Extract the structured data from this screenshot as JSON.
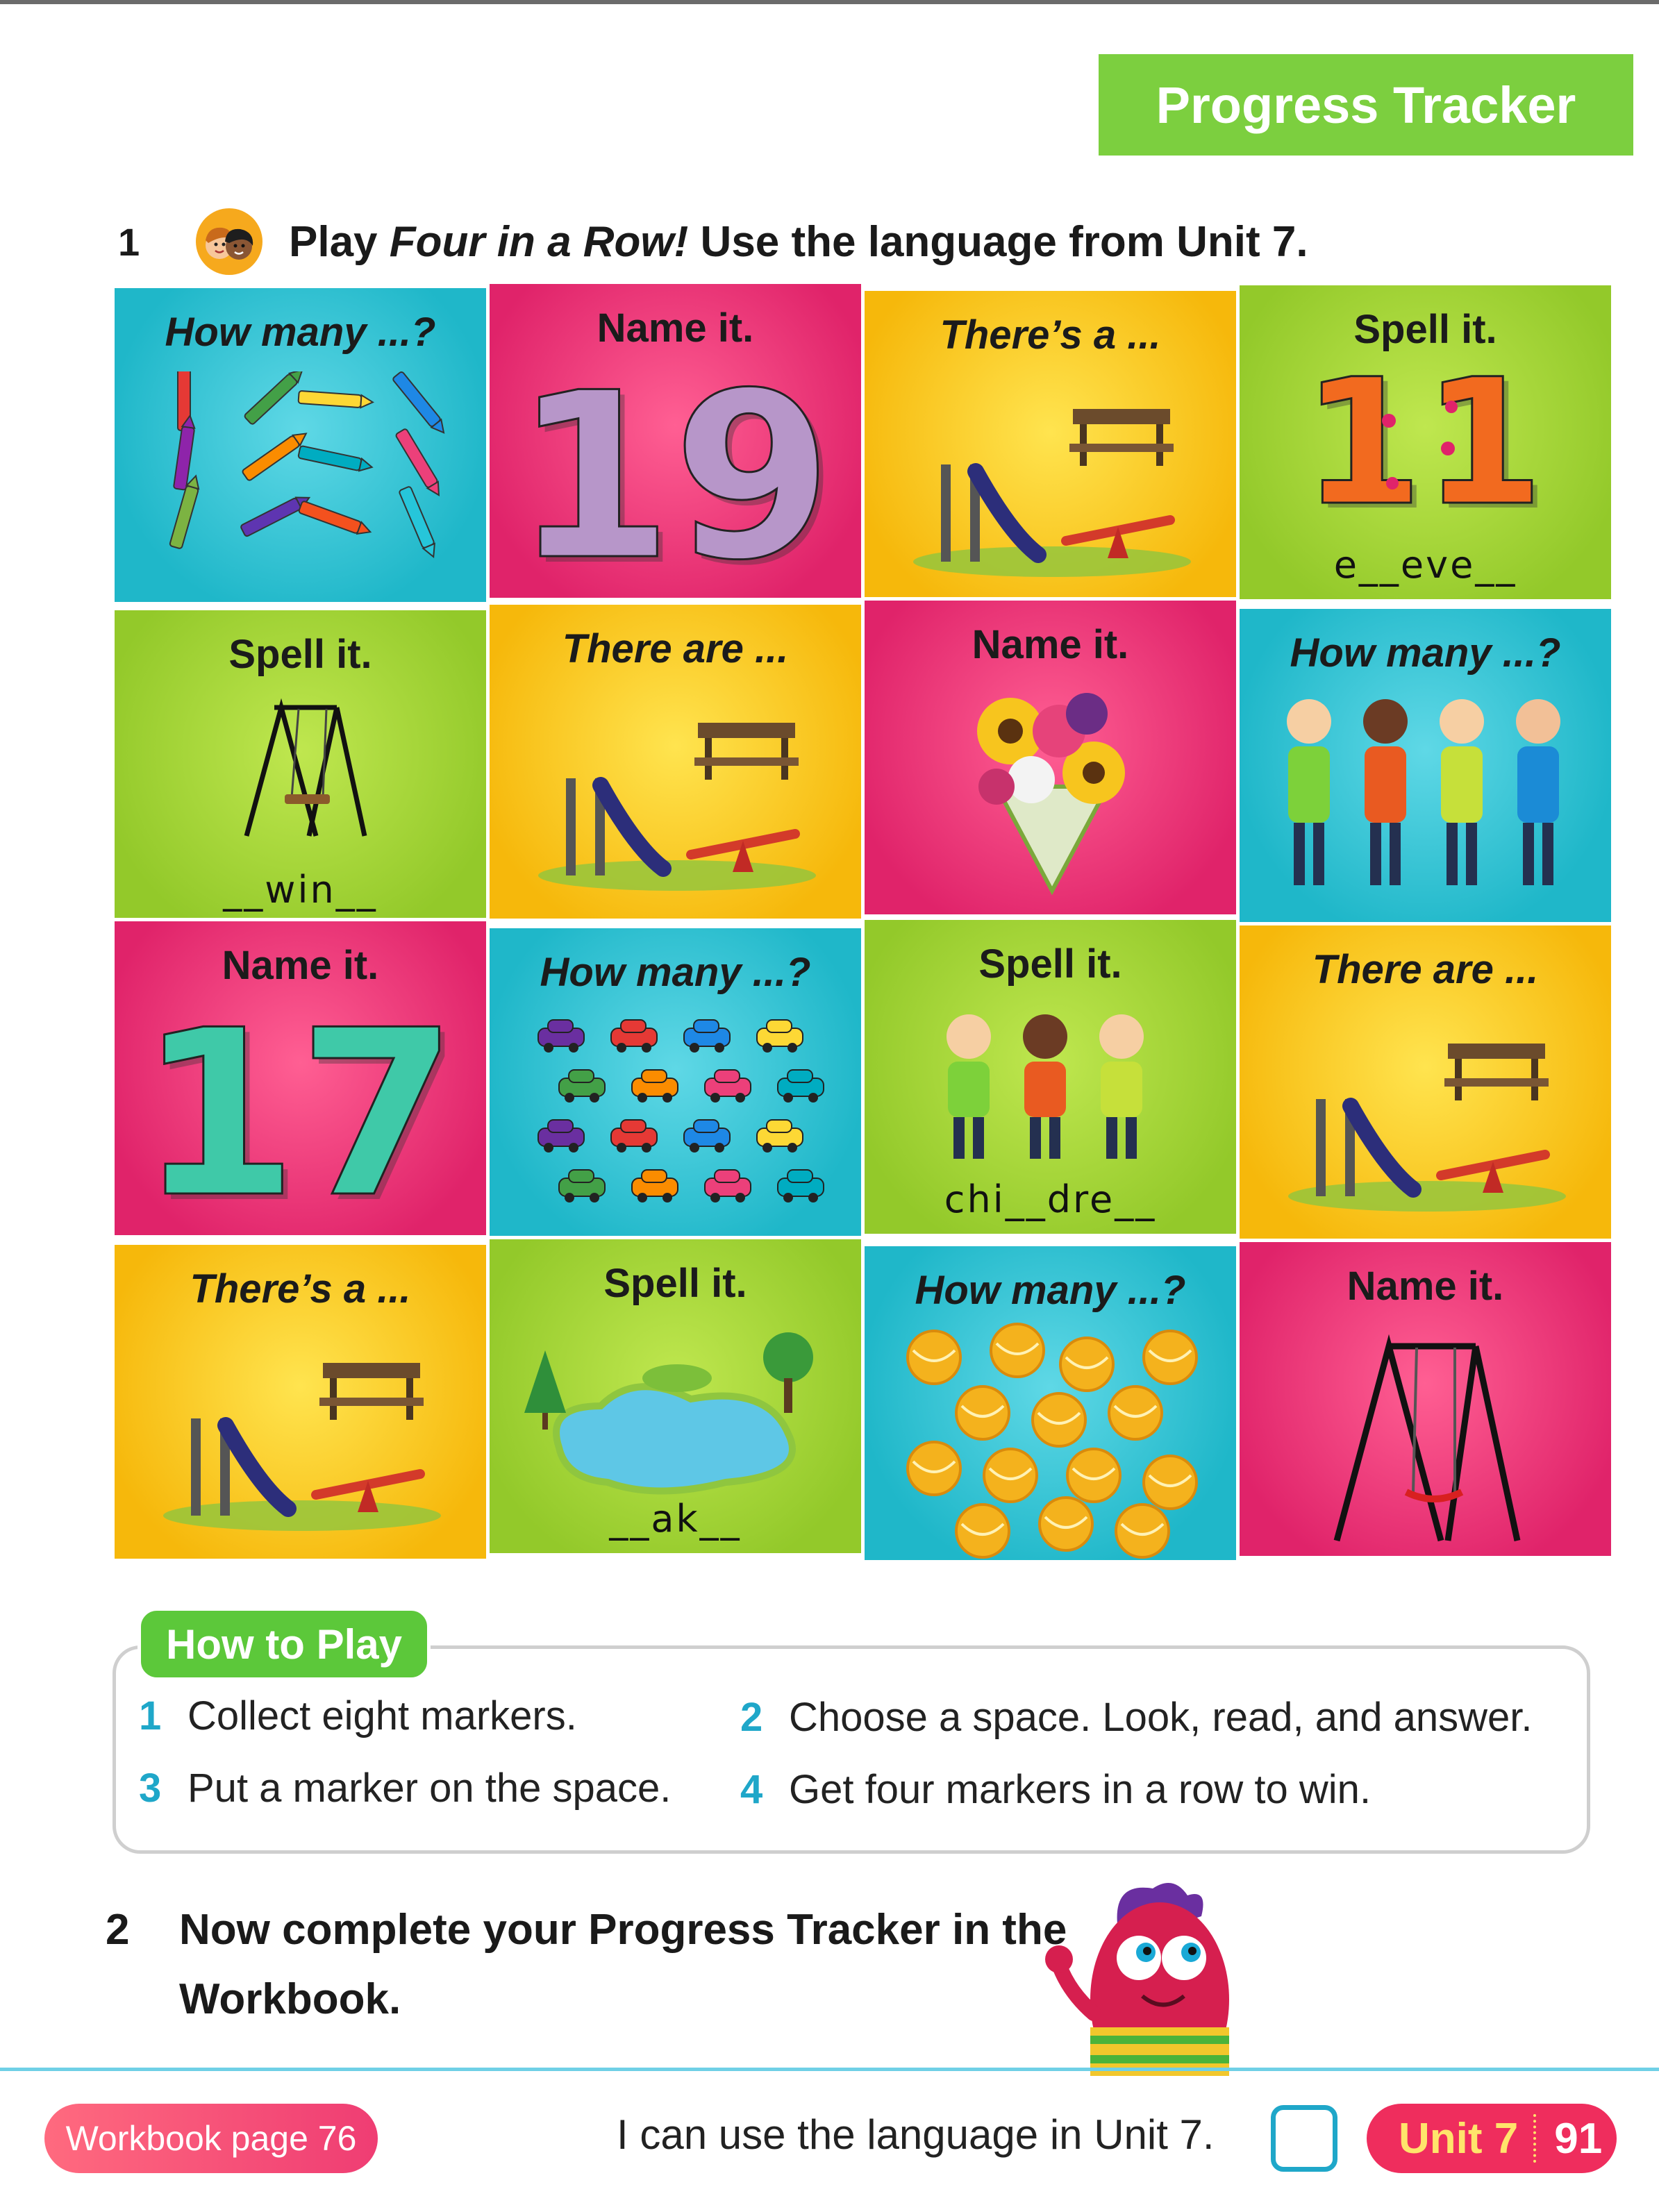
{
  "header": {
    "tab_title": "Progress Tracker"
  },
  "exercise1": {
    "number": "1",
    "text_before": "Play ",
    "text_game": "Four in a Row!",
    "text_after": " Use the language from Unit 7."
  },
  "board": {
    "tiles": [
      {
        "prompt": "How many ...?",
        "spell": "",
        "color": "#1fb7c9",
        "picture": "crayons"
      },
      {
        "prompt": "Name it.",
        "spell": "",
        "color": "#e0236a",
        "picture": "number",
        "number": "19"
      },
      {
        "prompt": "There’s a ...",
        "spell": "",
        "color": "#f6b80b",
        "picture": "playground"
      },
      {
        "prompt": "Spell it.",
        "spell": "e__eve__",
        "color": "#93c92a",
        "picture": "number",
        "number": "11"
      },
      {
        "prompt": "Spell it.",
        "spell": "__win__",
        "color": "#93c92a",
        "picture": "swing"
      },
      {
        "prompt": "There are ...",
        "spell": "",
        "color": "#f6b80b",
        "picture": "playground"
      },
      {
        "prompt": "Name it.",
        "spell": "",
        "color": "#e0236a",
        "picture": "flowers"
      },
      {
        "prompt": "How many ...?",
        "spell": "",
        "color": "#1fb7c9",
        "picture": "people"
      },
      {
        "prompt": "Name it.",
        "spell": "",
        "color": "#e0236a",
        "picture": "number",
        "number": "17"
      },
      {
        "prompt": "How many ...?",
        "spell": "",
        "color": "#1fb7c9",
        "picture": "cars"
      },
      {
        "prompt": "Spell it.",
        "spell": "chi__dre__",
        "color": "#93c92a",
        "picture": "children"
      },
      {
        "prompt": "There are ...",
        "spell": "",
        "color": "#f6b80b",
        "picture": "playground"
      },
      {
        "prompt": "There’s a ...",
        "spell": "",
        "color": "#f6b80b",
        "picture": "playground"
      },
      {
        "prompt": "Spell it.",
        "spell": "__ak__",
        "color": "#93c92a",
        "picture": "lake"
      },
      {
        "prompt": "How many ...?",
        "spell": "",
        "color": "#1fb7c9",
        "picture": "balls"
      },
      {
        "prompt": "Name it.",
        "spell": "",
        "color": "#e0236a",
        "picture": "swing"
      }
    ]
  },
  "how_to_play": {
    "title": "How to Play",
    "steps": [
      {
        "n": "1",
        "text": "Collect eight markers."
      },
      {
        "n": "2",
        "text": "Choose a space. Look, read, and answer."
      },
      {
        "n": "3",
        "text": "Put a marker on the space."
      },
      {
        "n": "4",
        "text": "Get four markers in a row to win."
      }
    ]
  },
  "exercise2": {
    "number": "2",
    "text": "Now complete your Progress Tracker in the Workbook."
  },
  "footer": {
    "workbook": "Workbook page 76",
    "ican": "I can use the language in Unit 7.",
    "unit": "Unit 7",
    "page": "91"
  }
}
